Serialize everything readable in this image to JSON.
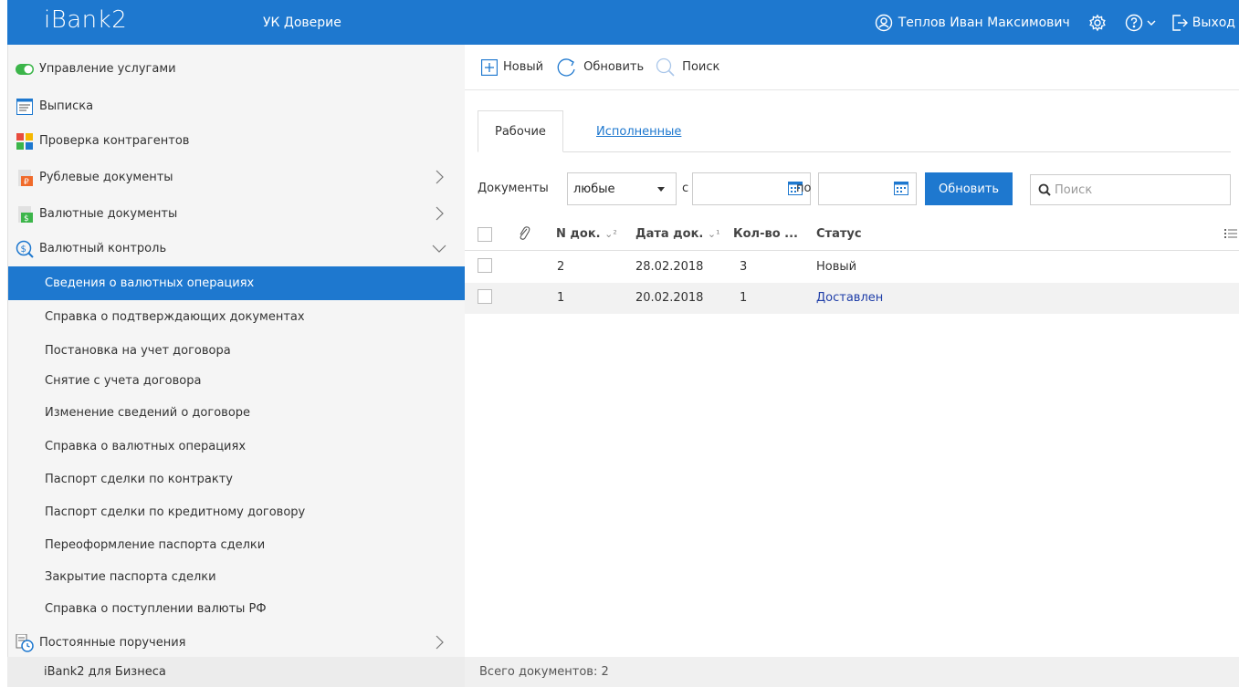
{
  "header": {
    "logo": "iBank2",
    "org": "УК Доверие",
    "user": "Теплов Иван Максимович",
    "logout": "Выход"
  },
  "sidebar": {
    "items": [
      {
        "label": "Управление услугами",
        "icon": "toggle-icon"
      },
      {
        "label": "Выписка",
        "icon": "statement-icon"
      },
      {
        "label": "Проверка контрагентов",
        "icon": "counterparty-check-icon"
      },
      {
        "label": "Рублевые документы",
        "icon": "ruble-doc-icon"
      },
      {
        "label": "Валютные документы",
        "icon": "currency-doc-icon"
      },
      {
        "label": "Валютный контроль",
        "icon": "currency-control-icon"
      }
    ],
    "subitems": [
      "Сведения о валютных операциях",
      "Справка о подтверждающих документах",
      "Постановка на учет договора",
      "Снятие с учета договора",
      "Изменение сведений о договоре",
      "Справка о валютных операциях",
      "Паспорт сделки по контракту",
      "Паспорт сделки по кредитному договору",
      "Переоформление паспорта сделки",
      "Закрытие паспорта сделки",
      "Справка о поступлении валюты РФ"
    ],
    "last_item": {
      "label": "Постоянные поручения",
      "icon": "standing-order-icon"
    },
    "footer": "iBank2 для Бизнеса"
  },
  "toolbar": {
    "new_label": "Новый",
    "refresh_label": "Обновить",
    "search_label": "Поиск"
  },
  "tabs": {
    "working": "Рабочие",
    "executed": "Исполненные"
  },
  "filter": {
    "docs_label": "Документы",
    "docs_value": "любые",
    "from_label": "с",
    "to_label": "по",
    "refresh_button": "Обновить",
    "search_placeholder": "Поиск"
  },
  "table": {
    "columns": {
      "num": "N док.",
      "num_sort": "⌄²",
      "date": "Дата док.",
      "date_sort": "⌄¹",
      "count": "Кол-во ...",
      "status": "Статус"
    },
    "rows": [
      {
        "num": "2",
        "date": "28.02.2018",
        "count": "3",
        "status": "Новый"
      },
      {
        "num": "1",
        "date": "20.02.2018",
        "count": "1",
        "status": "Доставлен"
      }
    ]
  },
  "footer": {
    "total": "Всего документов: 2"
  },
  "colors": {
    "accent": "#1e78cf",
    "toggle_on": "#3cb54a",
    "status_link": "#1f3ea8"
  }
}
